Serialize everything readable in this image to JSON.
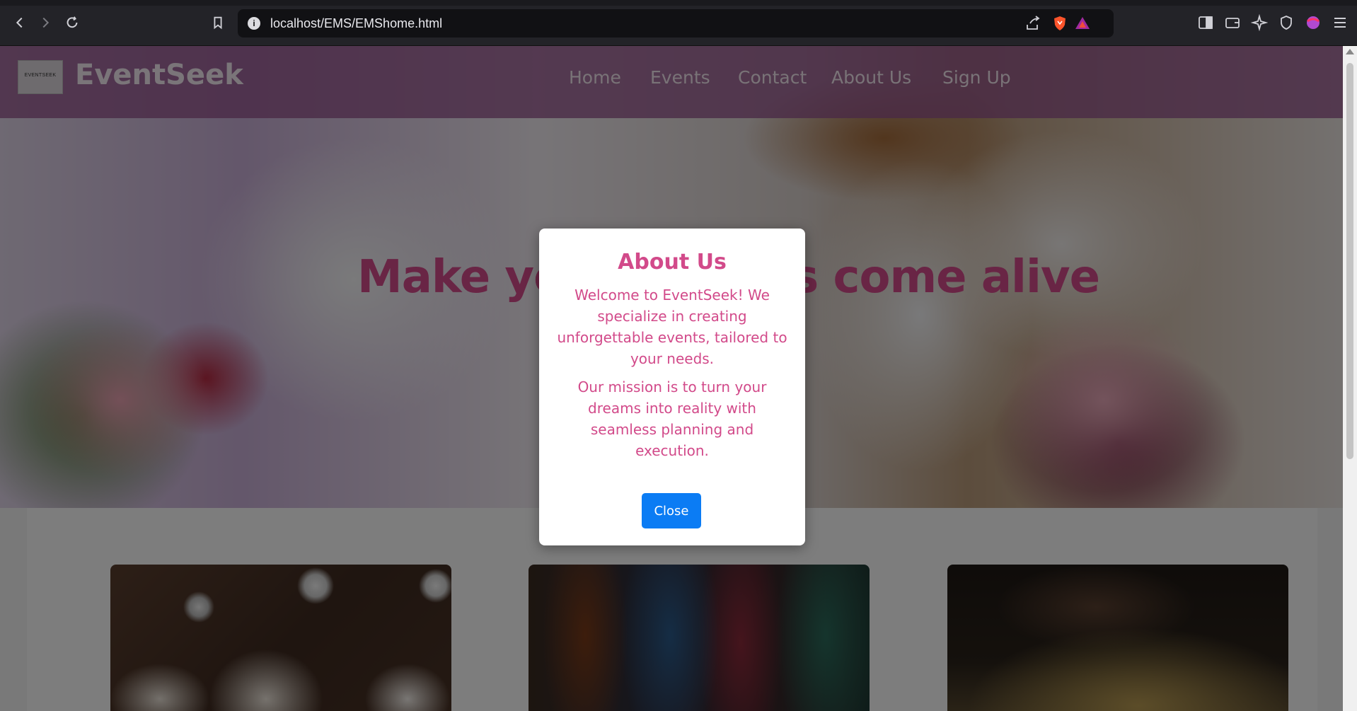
{
  "browser": {
    "url": "localhost/EMS/EMShome.html"
  },
  "site": {
    "brand": "EventSeek",
    "logo_text": "EVENTSEEK",
    "nav": [
      "Home",
      "Events",
      "Contact",
      "About Us",
      "Sign Up"
    ],
    "hero_title": "Make your dreams come alive"
  },
  "modal": {
    "title": "About Us",
    "paragraph1": "Welcome to EventSeek! We specialize in creating unforgettable events, tailored to your needs.",
    "paragraph2": "Our mission is to turn your dreams into reality with seamless planning and execution.",
    "close_label": "Close"
  },
  "colors": {
    "accent": "#d24a8a",
    "button": "#0b7cf4",
    "header": "#94528c"
  }
}
